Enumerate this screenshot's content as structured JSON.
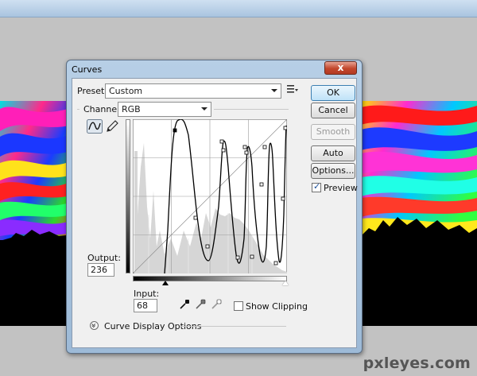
{
  "dialog": {
    "title": "Curves",
    "close_label": "x",
    "preset_label": "Preset:",
    "preset_value": "Custom",
    "channel_label": "Channel:",
    "channel_value": "RGB",
    "output_label": "Output:",
    "output_value": "236",
    "input_label": "Input:",
    "input_value": "68",
    "show_clipping_label": "Show Clipping",
    "show_clipping_checked": false,
    "curve_display_options_label": "Curve Display Options",
    "buttons": {
      "ok": "OK",
      "cancel": "Cancel",
      "smooth": "Smooth",
      "auto": "Auto",
      "options": "Options..."
    },
    "preview_label": "Preview",
    "preview_checked": true
  },
  "watermark": "pxleyes.com",
  "icons": [
    "preset-options-icon",
    "curve-tool-icon",
    "pencil-tool-icon",
    "black-eyedropper-icon",
    "gray-eyedropper-icon",
    "white-eyedropper-icon",
    "chevron-down-icon"
  ],
  "colors": {
    "title_bar": "#a9c4df",
    "close_button": "#c2462c",
    "default_button": "#bfe2f8",
    "dialog_body": "#f0f0f0"
  }
}
